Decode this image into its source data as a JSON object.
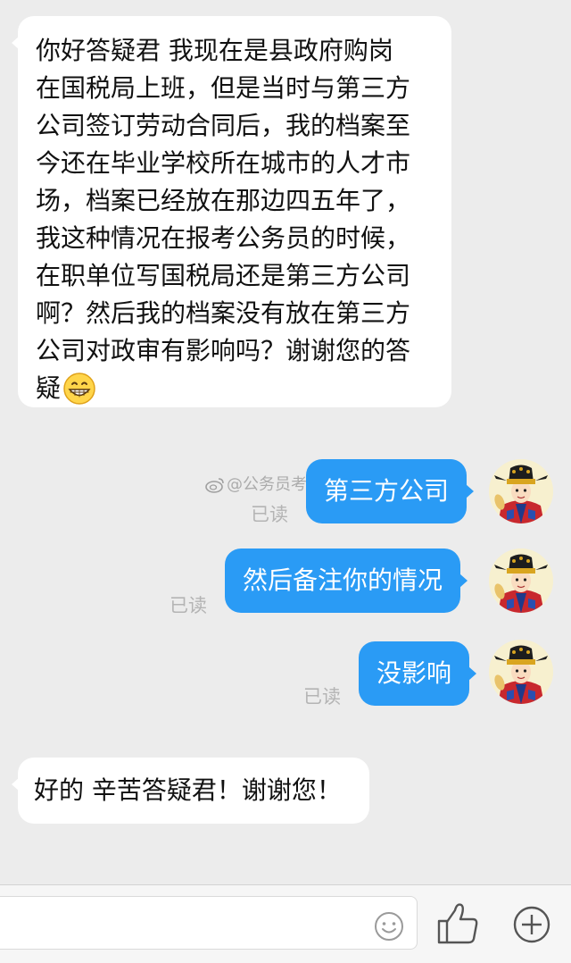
{
  "messages": [
    {
      "side": "left",
      "lines": [
        "你好答疑君  我现在是县政府购岗",
        "在国税局上班，但是当时与第三方",
        "公司签订劳动合同后，我的档案至",
        "今还在毕业学校所在城市的人才市",
        "场，档案已经放在那边四五年了，",
        "我这种情况在报考公务员的时候，",
        "在职单位写国税局还是第三方公司",
        "啊？然后我的档案没有放在第三方",
        "公司对政审有影响吗？谢谢您的答",
        "疑"
      ],
      "emoji": "grinning-face"
    },
    {
      "side": "right",
      "text": "第三方公司",
      "status": "已读"
    },
    {
      "side": "right",
      "text": "然后备注你的情况",
      "status": "已读"
    },
    {
      "side": "right",
      "text": "没影响",
      "status": "已读"
    },
    {
      "side": "left",
      "text": "好的  辛苦答疑君！谢谢您！"
    }
  ],
  "watermark": "@公务员考试答疑君",
  "input": {
    "placeholder": ""
  },
  "toolbar": {
    "emoji_icon": "smiley-icon",
    "like_icon": "thumbs-up-icon",
    "add_icon": "plus-circle-icon"
  },
  "colors": {
    "background": "#ececec",
    "sent_bubble": "#2a9bf5",
    "received_bubble": "#ffffff",
    "read_status": "#b4b4b4"
  }
}
